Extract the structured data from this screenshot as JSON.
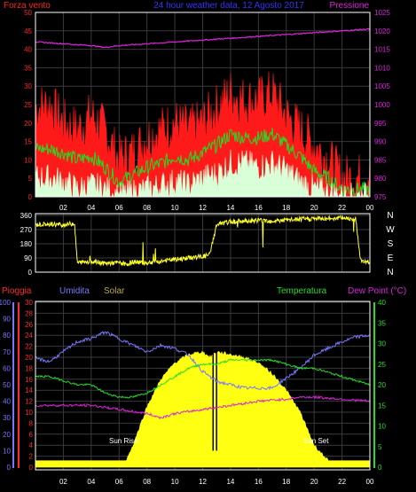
{
  "colors": {
    "background": "#000000",
    "grid": "#3a3a3a",
    "axis": "#ffffff",
    "wind": "#ff1a1a",
    "wind_avg": "#22dd22",
    "wind_min": "#d8ffd8",
    "pressure": "#dd22dd",
    "direction": "#ffff22",
    "pioggia": "#ff2a2a",
    "umidita": "#7777ff",
    "solar": "#ffff11",
    "temperatura": "#22dd22",
    "dew": "#dd22dd"
  },
  "chart_data": [
    {
      "type": "line",
      "title": "24 hour weather data, 12 Agosto 2017",
      "left_label": "Forza vento",
      "right_label": "Pressione",
      "left_ticks": [
        "0",
        "5",
        "10",
        "15",
        "20",
        "25",
        "30",
        "35",
        "40",
        "45",
        "50"
      ],
      "right_ticks": [
        "975",
        "980",
        "985",
        "990",
        "995",
        "1000",
        "1005",
        "1010",
        "1015",
        "1020",
        "1025"
      ],
      "x_ticks": [
        "02",
        "04",
        "06",
        "08",
        "10",
        "12",
        "14",
        "16",
        "18",
        "20",
        "22",
        "00"
      ],
      "ylim_left": [
        0,
        50
      ],
      "ylim_right": [
        975,
        1025
      ],
      "series": [
        {
          "name": "Forza vento",
          "hours": [
            0,
            1,
            2,
            3,
            4,
            5,
            6,
            7,
            8,
            9,
            10,
            11,
            12,
            13,
            14,
            15,
            16,
            17,
            18,
            19,
            20,
            21,
            22,
            23,
            24
          ],
          "values": [
            24,
            25,
            20,
            18,
            22,
            18,
            10,
            12,
            16,
            18,
            20,
            18,
            20,
            24,
            28,
            26,
            26,
            28,
            22,
            18,
            14,
            10,
            5,
            5,
            6
          ]
        },
        {
          "name": "",
          "hours": [
            0,
            1,
            2,
            3,
            4,
            5,
            6,
            7,
            8,
            9,
            10,
            11,
            12,
            13,
            14,
            15,
            16,
            17,
            18,
            19,
            20,
            21,
            22,
            23,
            24
          ],
          "values": [
            13,
            13,
            12,
            10,
            11,
            8,
            4,
            6,
            8,
            9,
            11,
            10,
            12,
            14,
            17,
            16,
            16,
            17,
            14,
            11,
            7,
            5,
            2,
            2,
            2
          ]
        },
        {
          "name": "",
          "hours": [
            0,
            1,
            2,
            3,
            4,
            5,
            6,
            7,
            8,
            9,
            10,
            11,
            12,
            13,
            14,
            15,
            16,
            17,
            18,
            19,
            20,
            21,
            22,
            23,
            24
          ],
          "values": [
            5,
            5,
            4,
            2,
            3,
            2,
            0,
            1,
            2,
            3,
            4,
            3,
            5,
            6,
            9,
            9,
            8,
            9,
            7,
            4,
            2,
            1,
            0,
            0,
            0
          ]
        },
        {
          "name": "Pressione",
          "hours": [
            0,
            2,
            4,
            5,
            6,
            8,
            10,
            12,
            14,
            16,
            18,
            20,
            22,
            24
          ],
          "values": [
            1017,
            1016.5,
            1016,
            1015.5,
            1016,
            1016.5,
            1017,
            1017.5,
            1018,
            1018.5,
            1019,
            1019.5,
            1020,
            1020.5
          ]
        }
      ]
    },
    {
      "type": "line",
      "title": "",
      "left_ticks": [
        "0",
        "90",
        "180",
        "270",
        "360"
      ],
      "right_labels": [
        "N",
        "W",
        "S",
        "E",
        "N"
      ],
      "ylim": [
        0,
        360
      ],
      "series": [
        {
          "name": "",
          "hours": [
            0,
            1,
            2,
            2.8,
            3,
            4,
            5,
            6,
            6.5,
            7,
            8,
            9,
            10,
            11,
            12,
            12.5,
            13,
            14,
            15,
            16,
            17,
            18,
            19,
            20,
            21,
            22,
            23,
            23.3,
            23.5,
            24
          ],
          "values": [
            300,
            305,
            300,
            310,
            60,
            70,
            55,
            60,
            50,
            65,
            60,
            70,
            80,
            90,
            100,
            110,
            300,
            320,
            325,
            330,
            325,
            330,
            335,
            340,
            340,
            345,
            340,
            80,
            60,
            70
          ]
        }
      ]
    },
    {
      "type": "area",
      "title": "",
      "legend": [
        "Pioggia",
        "Umidita",
        "Solar",
        "Temperatura",
        "Dew Point (°C)"
      ],
      "umidita_ticks": [
        "0",
        "10",
        "20",
        "30",
        "40",
        "50",
        "60",
        "70",
        "80",
        "90",
        "100"
      ],
      "pioggia_ticks": [
        "0",
        "2",
        "4",
        "6",
        "8",
        "10",
        "12",
        "14",
        "16",
        "18",
        "20",
        "22",
        "24",
        "26",
        "28",
        "30"
      ],
      "temp_ticks": [
        "0",
        "5",
        "10",
        "15",
        "20",
        "25",
        "30",
        "35",
        "40"
      ],
      "x_ticks": [
        "02",
        "04",
        "06",
        "08",
        "10",
        "12",
        "14",
        "16",
        "18",
        "20",
        "22",
        "00"
      ],
      "annotations": [
        "Sun Rise",
        "Sun Set"
      ],
      "series": [
        {
          "name": "Umidita",
          "hours": [
            0,
            1,
            2,
            3,
            4,
            5,
            6,
            7,
            8,
            9,
            10,
            11,
            12,
            13,
            14,
            15,
            16,
            17,
            18,
            19,
            20,
            21,
            22,
            23,
            24
          ],
          "values": [
            66,
            64,
            70,
            76,
            78,
            82,
            78,
            74,
            70,
            74,
            72,
            68,
            58,
            52,
            50,
            48,
            48,
            48,
            54,
            60,
            68,
            72,
            76,
            79,
            80
          ]
        },
        {
          "name": "Temperatura",
          "hours": [
            0,
            1,
            2,
            3,
            4,
            5,
            6,
            7,
            8,
            9,
            10,
            11,
            12,
            13,
            14,
            15,
            16,
            17,
            18,
            19,
            20,
            21,
            22,
            23,
            24
          ],
          "values": [
            22,
            22,
            21,
            20,
            20,
            18,
            17,
            17,
            18,
            20,
            22,
            24,
            25,
            25,
            26,
            26,
            26,
            26,
            25,
            24,
            24,
            23,
            22,
            21,
            20
          ]
        },
        {
          "name": "Dew Point (°C)",
          "hours": [
            0,
            2,
            4,
            6,
            8,
            9,
            10,
            12,
            14,
            16,
            18,
            19,
            20,
            22,
            24
          ],
          "values": [
            15,
            15,
            15,
            14,
            13,
            12,
            13,
            14,
            15,
            16,
            16.5,
            17,
            17,
            16.5,
            16
          ]
        },
        {
          "name": "Solar",
          "hours": [
            0,
            6.5,
            7,
            8,
            9,
            10,
            11,
            12,
            12.5,
            13,
            14,
            15,
            16,
            17,
            18,
            19,
            20,
            21,
            24
          ],
          "values": [
            1.2,
            1.2,
            4,
            11,
            16,
            19,
            20.5,
            21,
            20,
            21,
            20.5,
            20,
            19,
            17,
            14,
            10,
            4,
            1.2,
            1.2
          ]
        }
      ]
    }
  ]
}
